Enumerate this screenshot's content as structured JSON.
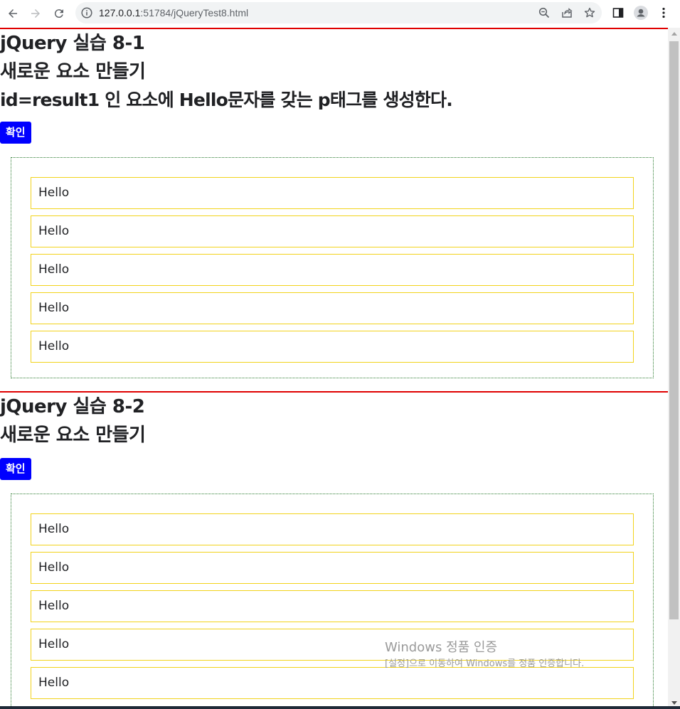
{
  "browser": {
    "url_host": "127.0.0.1",
    "url_rest": ":51784/jQueryTest8.html"
  },
  "sections": [
    {
      "title": "jQuery 실습 8-1",
      "subtitle": "새로운 요소 만들기",
      "description": "id=result1 인 요소에 Hello문자를 갖는 p태그를 생성한다.",
      "button_label": "확인",
      "items": [
        "Hello",
        "Hello",
        "Hello",
        "Hello",
        "Hello"
      ]
    },
    {
      "title": "jQuery 실습 8-2",
      "subtitle": "새로운 요소 만들기",
      "button_label": "확인",
      "items": [
        "Hello",
        "Hello",
        "Hello",
        "Hello",
        "Hello"
      ]
    }
  ],
  "watermark": {
    "title": "Windows 정품 인증",
    "subtitle": "[설정]으로 이동하여 Windows를 정품 인증합니다."
  },
  "colors": {
    "section_border": "#e00000",
    "button_bg": "#0000ff",
    "item_border": "#f2d31b",
    "box_border": "#2e7d32"
  }
}
